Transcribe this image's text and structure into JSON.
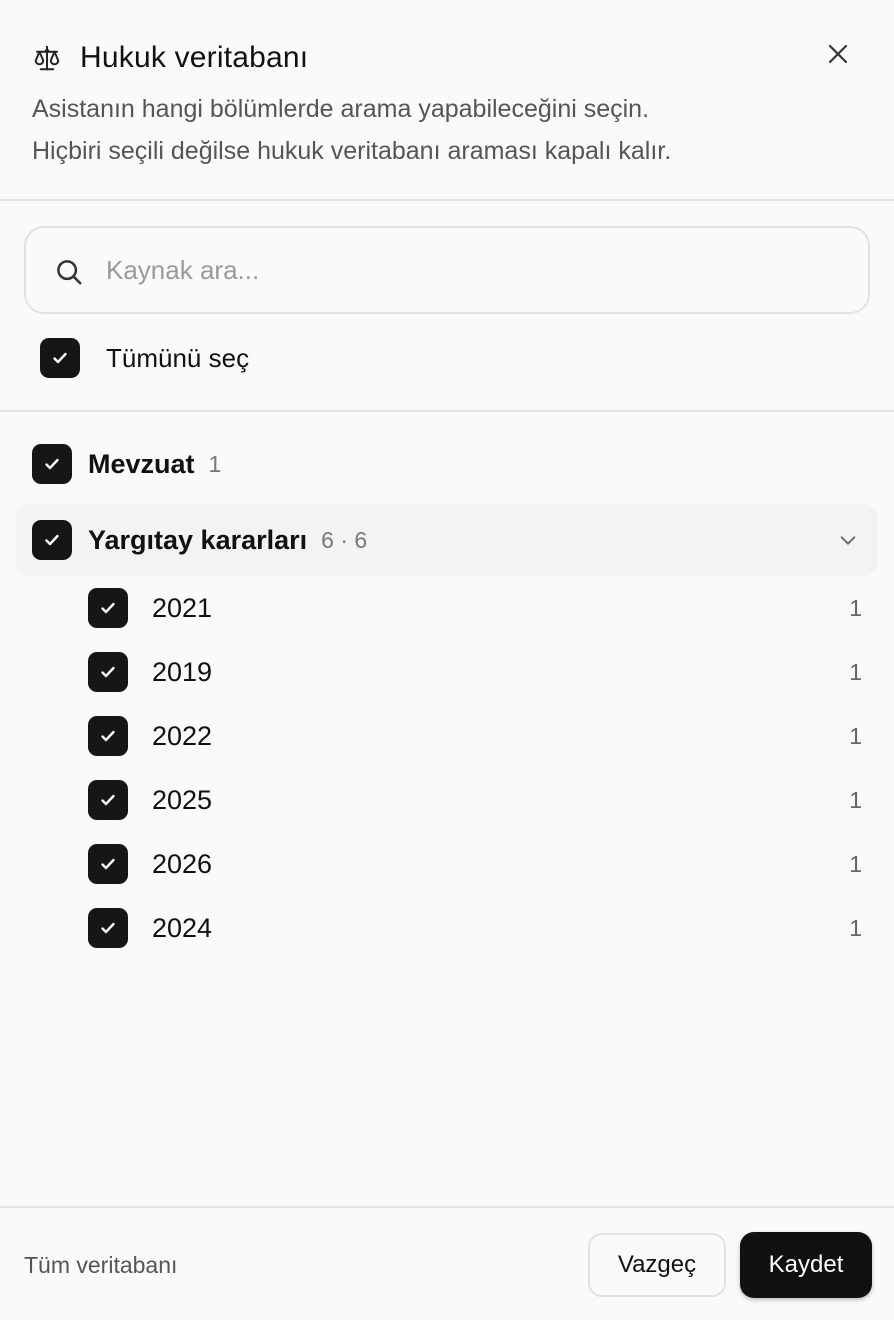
{
  "header": {
    "title": "Hukuk veritabanı",
    "description_line1": "Asistanın hangi bölümlerde arama yapabileceğini seçin.",
    "description_line2": "Hiçbiri seçili değilse hukuk veritabanı araması kapalı kalır.",
    "icon": "scale-icon"
  },
  "search": {
    "placeholder": "Kaynak ara...",
    "value": ""
  },
  "select_all": {
    "label": "Tümünü seç",
    "checked": true
  },
  "groups": [
    {
      "name": "Mevzuat",
      "count": "1",
      "checked": true,
      "expanded": false
    },
    {
      "name": "Yargıtay kararları",
      "count": "6 · 6",
      "checked": true,
      "expanded": true,
      "years": [
        {
          "year": "2021",
          "count": "1",
          "checked": true
        },
        {
          "year": "2019",
          "count": "1",
          "checked": true
        },
        {
          "year": "2022",
          "count": "1",
          "checked": true
        },
        {
          "year": "2025",
          "count": "1",
          "checked": true
        },
        {
          "year": "2026",
          "count": "1",
          "checked": true
        },
        {
          "year": "2024",
          "count": "1",
          "checked": true
        }
      ]
    }
  ],
  "footer": {
    "label": "Tüm veritabanı",
    "cancel": "Vazgeç",
    "save": "Kaydet"
  },
  "colors": {
    "checkbox": "#161616",
    "primary_button": "#111111",
    "background": "#fafafa"
  }
}
